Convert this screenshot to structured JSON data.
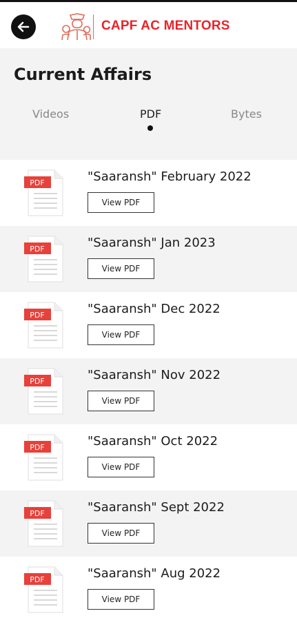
{
  "header": {
    "brand": "CAPF AC MENTORS",
    "back_icon": "arrow-left-icon",
    "logo_icon": "officers-logo-icon",
    "brand_color": "#e8242a"
  },
  "page": {
    "title": "Current Affairs"
  },
  "tabs": [
    {
      "label": "Videos",
      "active": false
    },
    {
      "label": "PDF",
      "active": true
    },
    {
      "label": "Bytes",
      "active": false
    }
  ],
  "items": [
    {
      "title": "\"Saaransh\" February 2022",
      "button": "View PDF",
      "icon_label": "PDF"
    },
    {
      "title": "\"Saaransh\" Jan 2023",
      "button": "View PDF",
      "icon_label": "PDF"
    },
    {
      "title": "\"Saaransh\" Dec 2022",
      "button": "View PDF",
      "icon_label": "PDF"
    },
    {
      "title": "\"Saaransh\" Nov 2022",
      "button": "View PDF",
      "icon_label": "PDF"
    },
    {
      "title": "\"Saaransh\" Oct 2022",
      "button": "View PDF",
      "icon_label": "PDF"
    },
    {
      "title": "\"Saaransh\" Sept 2022",
      "button": "View PDF",
      "icon_label": "PDF"
    },
    {
      "title": "\"Saaransh\" Aug 2022",
      "button": "View PDF",
      "icon_label": "PDF"
    }
  ]
}
